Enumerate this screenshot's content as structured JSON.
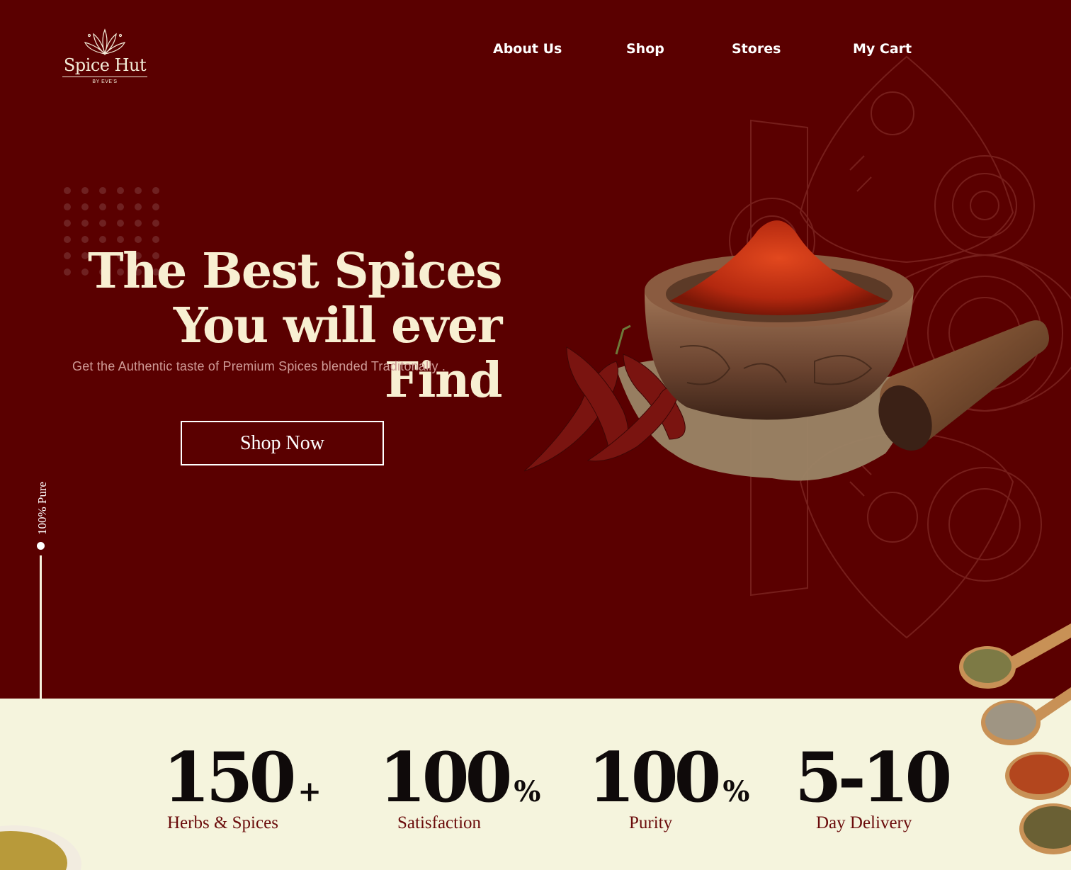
{
  "brand": {
    "name": "Spice Hut",
    "sub": "BY EVE'S"
  },
  "nav": {
    "about": "About Us",
    "shop": "Shop",
    "stores": "Stores",
    "cart": "My Cart"
  },
  "hero": {
    "headline_line1": "The Best Spices",
    "headline_line2": "You will ever Find",
    "subtitle": "Get the Authentic taste of Premium Spices blended Traditonally .",
    "cta": "Shop Now",
    "side_label": "100% Pure"
  },
  "stats": [
    {
      "value": "150",
      "suffix": "+",
      "label": "Herbs & Spices"
    },
    {
      "value": "100",
      "suffix": "%",
      "label": "Satisfaction"
    },
    {
      "value": "100",
      "suffix": "%",
      "label": "Purity"
    },
    {
      "value": "5-10",
      "suffix": "",
      "label": "Day Delivery"
    }
  ],
  "colors": {
    "background": "#5a0000",
    "cream": "#f5f4dd",
    "headline": "#f8efd2",
    "stat_label": "#6a0b0b"
  }
}
